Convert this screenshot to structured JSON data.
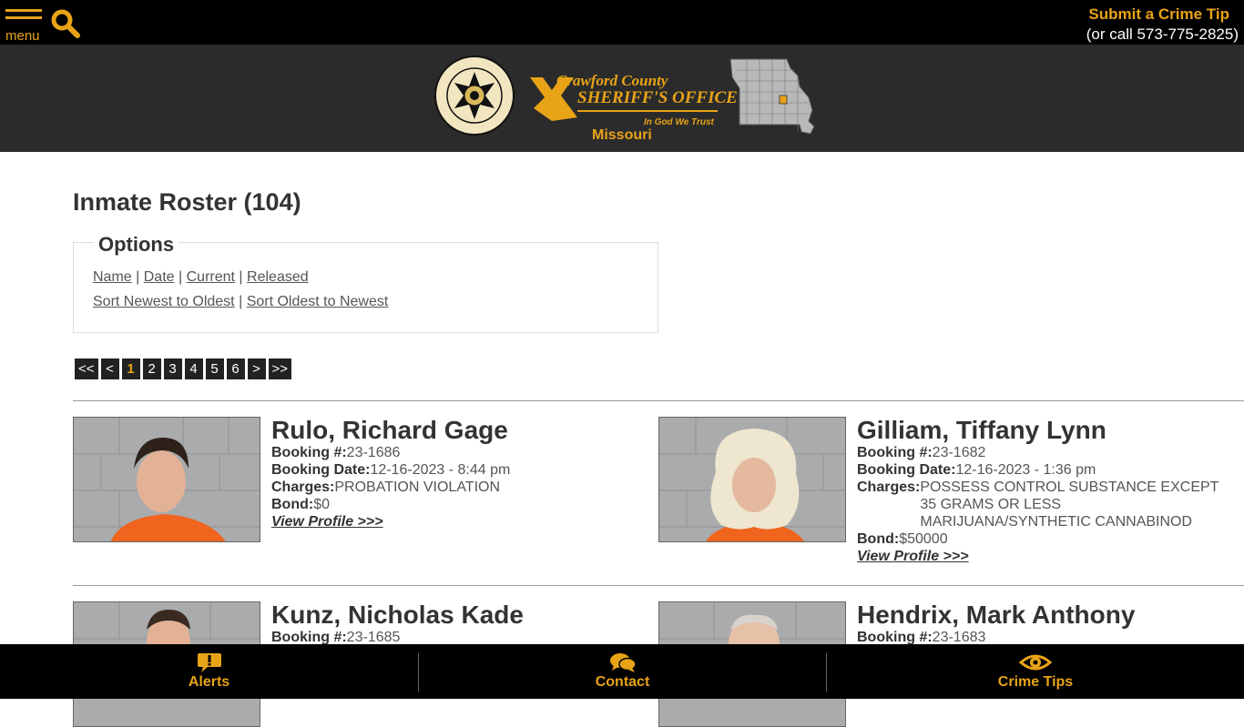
{
  "header": {
    "menu_label": "menu",
    "tip_title": "Submit a Crime Tip",
    "tip_phone": "(or call 573-775-2825)"
  },
  "banner": {
    "badge_text": "CRAWFORD COUNTY SHERIFF'S OFFICE",
    "brand_line1": "Crawford County",
    "brand_line2": "SHERIFF'S OFFICE",
    "brand_motto": "In God We Trust",
    "brand_state": "Missouri"
  },
  "page": {
    "title": "Inmate Roster (104)"
  },
  "options": {
    "legend": "Options",
    "sort_links": [
      "Name",
      "Date",
      "Current",
      "Released"
    ],
    "order_links": [
      "Sort Newest to Oldest",
      "Sort Oldest to Newest"
    ]
  },
  "pager": {
    "first": "<<",
    "prev": "<",
    "pages": [
      "1",
      "2",
      "3",
      "4",
      "5",
      "6"
    ],
    "current": "1",
    "next": ">",
    "last": ">>"
  },
  "labels": {
    "booking_no": "Booking #:",
    "booking_date": "Booking Date:",
    "charges": "Charges:",
    "bond": "Bond:",
    "view_profile": "View Profile >>>"
  },
  "inmates": [
    {
      "name": "Rulo, Richard Gage",
      "booking_no": "23-1686",
      "booking_date": "12-16-2023 - 8:44 pm",
      "charges": "PROBATION VIOLATION",
      "bond": "$0"
    },
    {
      "name": "Gilliam, Tiffany Lynn",
      "booking_no": "23-1682",
      "booking_date": "12-16-2023 - 1:36 pm",
      "charges": "POSSESS CONTROL SUBSTANCE EXCEPT 35 GRAMS OR LESS MARIJUANA/SYNTHETIC CANNABINOD",
      "bond": "$50000"
    },
    {
      "name": "Kunz, Nicholas Kade",
      "booking_no": "23-1685"
    },
    {
      "name": "Hendrix, Mark Anthony",
      "booking_no": "23-1683"
    }
  ],
  "footer": {
    "alerts": "Alerts",
    "contact": "Contact",
    "crime_tips": "Crime Tips"
  }
}
